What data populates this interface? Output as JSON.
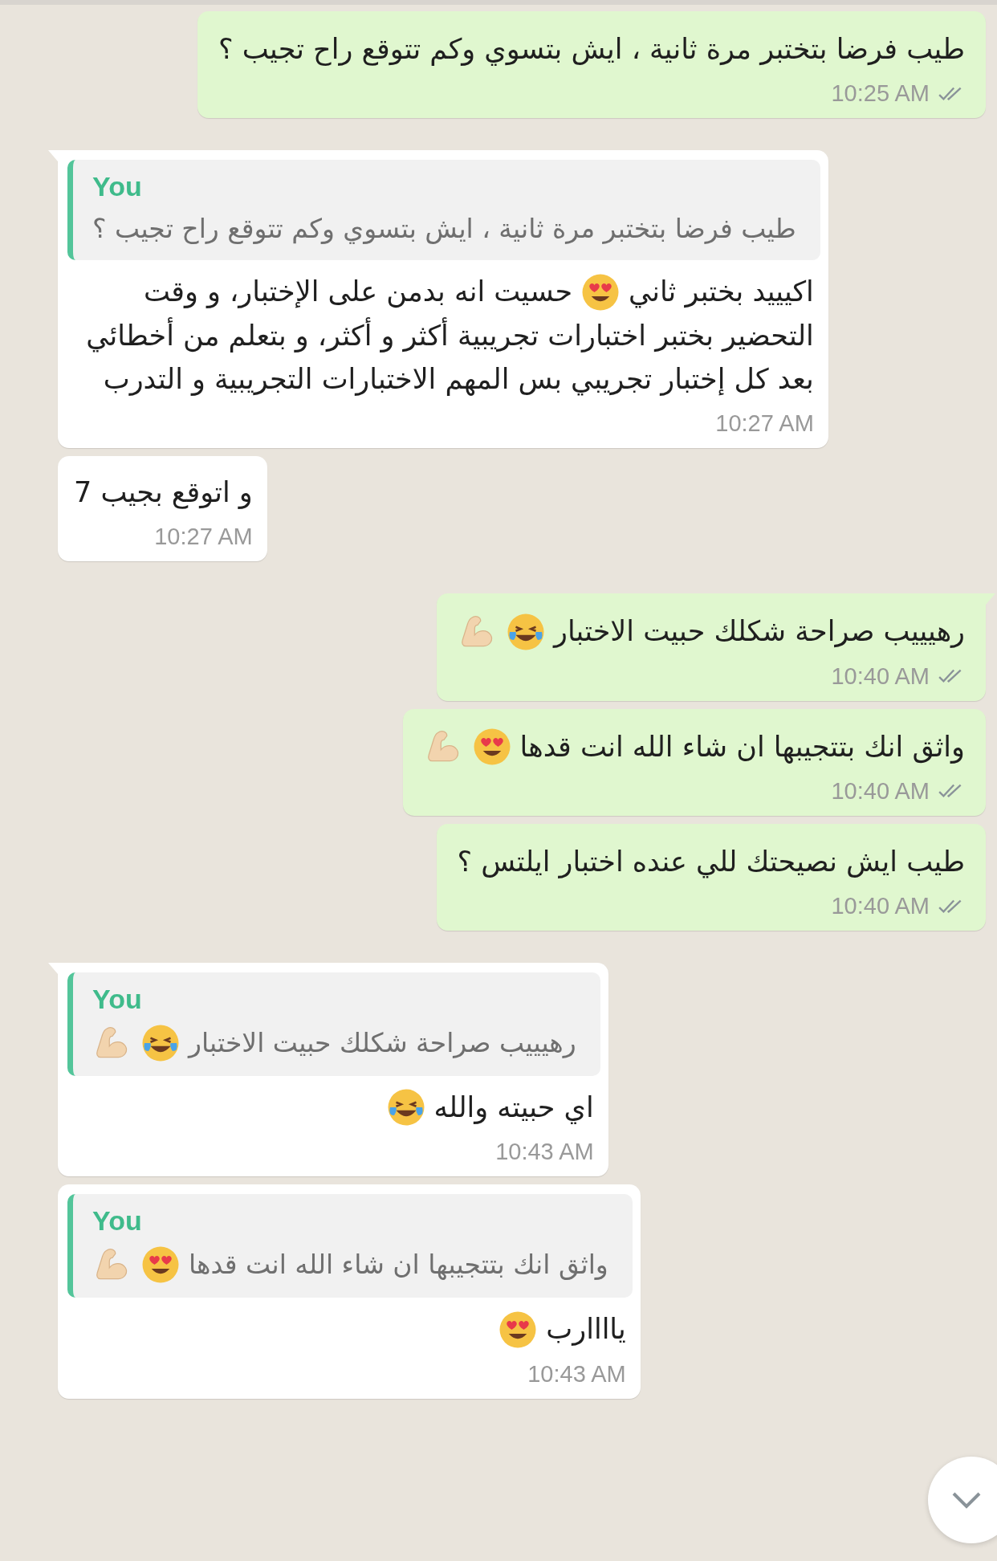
{
  "messages": [
    {
      "outgoing": true,
      "tail": false,
      "read": false,
      "lines": [
        [
          {
            "kind": "text",
            "text": "طيب فرضا بتختبر مرة ثانية ، ايش بتسوي وكم تتوقع راح تجيب ؟"
          }
        ]
      ],
      "time": "10:25 AM"
    },
    {
      "outgoing": false,
      "tail": true,
      "quote": {
        "author": "You",
        "lines": [
          [
            {
              "kind": "text",
              "text": "طيب فرضا بتختبر مرة ثانية ، ايش بتسوي وكم تتوقع راح تجيب ؟"
            }
          ]
        ]
      },
      "lines": [
        [
          {
            "kind": "text",
            "text": "اكيييد بختبر ثاني"
          },
          {
            "kind": "emoji_heart_eyes"
          },
          {
            "kind": "text",
            "text": "حسيت انه بدمن على الإختبار، و وقت"
          }
        ],
        [
          {
            "kind": "text",
            "text": "التحضير بختبر اختبارات تجريبية أكثر و أكثر، و بتعلم من أخطائي"
          }
        ],
        [
          {
            "kind": "text",
            "text": "بعد كل إختبار تجريبي بس المهم الاختبارات التجريبية و التدرب"
          }
        ]
      ],
      "time": "10:27 AM"
    },
    {
      "outgoing": false,
      "tail": false,
      "lines": [
        [
          {
            "kind": "text",
            "text": "و اتوقع بجيب 7"
          }
        ]
      ],
      "time": "10:27 AM"
    },
    {
      "outgoing": true,
      "tail": true,
      "read": false,
      "lines": [
        [
          {
            "kind": "text",
            "text": "رهيييب صراحة شكلك حبيت الاختبار"
          },
          {
            "kind": "emoji_laughing"
          },
          {
            "kind": "emoji_flexed_arm"
          }
        ]
      ],
      "time": "10:40 AM"
    },
    {
      "outgoing": true,
      "tail": false,
      "read": false,
      "lines": [
        [
          {
            "kind": "text",
            "text": "واثق انك بتتجيبها ان شاء الله انت قدها"
          },
          {
            "kind": "emoji_heart_eyes"
          },
          {
            "kind": "emoji_flexed_arm"
          }
        ]
      ],
      "time": "10:40 AM"
    },
    {
      "outgoing": true,
      "tail": false,
      "read": false,
      "lines": [
        [
          {
            "kind": "text",
            "text": "طيب ايش نصيحتك للي عنده اختبار ايلتس ؟"
          }
        ]
      ],
      "time": "10:40 AM"
    },
    {
      "outgoing": false,
      "tail": true,
      "quote": {
        "author": "You",
        "lines": [
          [
            {
              "kind": "text",
              "text": "رهيييب صراحة شكلك حبيت الاختبار"
            },
            {
              "kind": "emoji_laughing"
            },
            {
              "kind": "emoji_flexed_arm"
            }
          ]
        ]
      },
      "lines": [
        [
          {
            "kind": "text",
            "text": "اي حبيته والله"
          },
          {
            "kind": "emoji_laughing"
          }
        ]
      ],
      "time": "10:43 AM"
    },
    {
      "outgoing": false,
      "tail": false,
      "quote": {
        "author": "You",
        "lines": [
          [
            {
              "kind": "text",
              "text": "واثق انك بتتجيبها ان شاء الله انت قدها"
            },
            {
              "kind": "emoji_heart_eyes"
            },
            {
              "kind": "emoji_flexed_arm"
            }
          ]
        ]
      },
      "lines": [
        [
          {
            "kind": "text",
            "text": "ياااارب"
          },
          {
            "kind": "emoji_heart_eyes"
          }
        ]
      ],
      "time": "10:43 AM"
    }
  ]
}
